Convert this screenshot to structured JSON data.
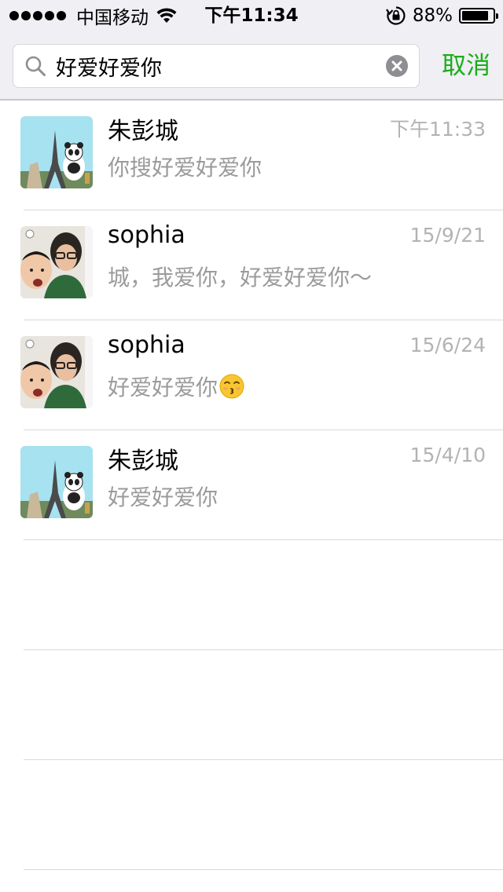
{
  "status_bar": {
    "carrier": "中国移动",
    "time": "下午11:34",
    "battery": "88%",
    "battery_level": 0.88
  },
  "search": {
    "query": "好爱好爱你",
    "cancel_label": "取消"
  },
  "results": [
    {
      "name": "朱彭城",
      "time": "下午11:33",
      "preview": "你搜好爱好爱你",
      "avatar": "eiffel-panda-avatar"
    },
    {
      "name": "sophia",
      "time": "15/9/21",
      "preview": "城，我爱你，好爱好爱你～",
      "avatar": "mother-child-selfie-avatar"
    },
    {
      "name": "sophia",
      "time": "15/6/24",
      "preview": "好爱好爱你",
      "avatar": "mother-child-selfie-avatar",
      "emoji": "kissing-face-icon"
    },
    {
      "name": "朱彭城",
      "time": "15/4/10",
      "preview": "好爱好爱你",
      "avatar": "eiffel-panda-avatar"
    }
  ],
  "colors": {
    "accent": "#1aad19",
    "header_bg": "#efeff4",
    "secondary_text": "#9b9b9b"
  }
}
